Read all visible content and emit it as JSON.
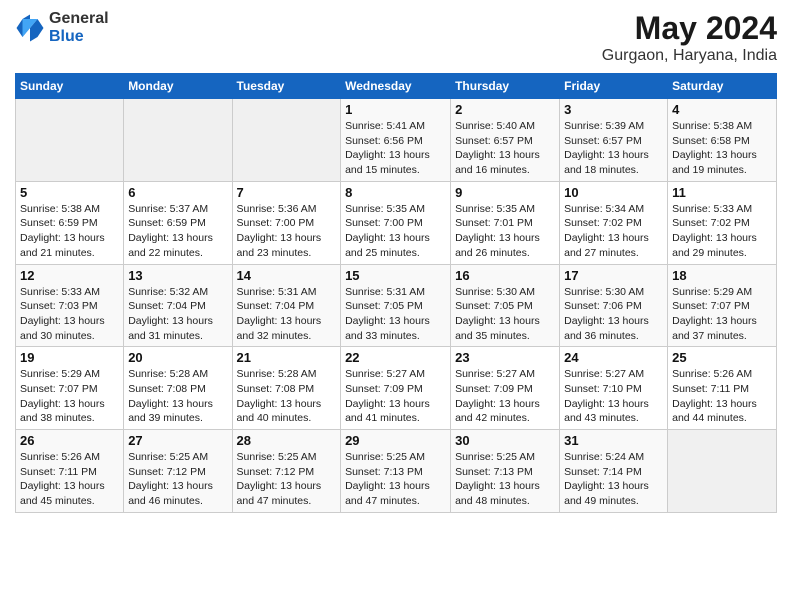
{
  "logo": {
    "general": "General",
    "blue": "Blue"
  },
  "title": "May 2024",
  "location": "Gurgaon, Haryana, India",
  "weekdays": [
    "Sunday",
    "Monday",
    "Tuesday",
    "Wednesday",
    "Thursday",
    "Friday",
    "Saturday"
  ],
  "weeks": [
    [
      {
        "day": "",
        "info": ""
      },
      {
        "day": "",
        "info": ""
      },
      {
        "day": "",
        "info": ""
      },
      {
        "day": "1",
        "info": "Sunrise: 5:41 AM\nSunset: 6:56 PM\nDaylight: 13 hours\nand 15 minutes."
      },
      {
        "day": "2",
        "info": "Sunrise: 5:40 AM\nSunset: 6:57 PM\nDaylight: 13 hours\nand 16 minutes."
      },
      {
        "day": "3",
        "info": "Sunrise: 5:39 AM\nSunset: 6:57 PM\nDaylight: 13 hours\nand 18 minutes."
      },
      {
        "day": "4",
        "info": "Sunrise: 5:38 AM\nSunset: 6:58 PM\nDaylight: 13 hours\nand 19 minutes."
      }
    ],
    [
      {
        "day": "5",
        "info": "Sunrise: 5:38 AM\nSunset: 6:59 PM\nDaylight: 13 hours\nand 21 minutes."
      },
      {
        "day": "6",
        "info": "Sunrise: 5:37 AM\nSunset: 6:59 PM\nDaylight: 13 hours\nand 22 minutes."
      },
      {
        "day": "7",
        "info": "Sunrise: 5:36 AM\nSunset: 7:00 PM\nDaylight: 13 hours\nand 23 minutes."
      },
      {
        "day": "8",
        "info": "Sunrise: 5:35 AM\nSunset: 7:00 PM\nDaylight: 13 hours\nand 25 minutes."
      },
      {
        "day": "9",
        "info": "Sunrise: 5:35 AM\nSunset: 7:01 PM\nDaylight: 13 hours\nand 26 minutes."
      },
      {
        "day": "10",
        "info": "Sunrise: 5:34 AM\nSunset: 7:02 PM\nDaylight: 13 hours\nand 27 minutes."
      },
      {
        "day": "11",
        "info": "Sunrise: 5:33 AM\nSunset: 7:02 PM\nDaylight: 13 hours\nand 29 minutes."
      }
    ],
    [
      {
        "day": "12",
        "info": "Sunrise: 5:33 AM\nSunset: 7:03 PM\nDaylight: 13 hours\nand 30 minutes."
      },
      {
        "day": "13",
        "info": "Sunrise: 5:32 AM\nSunset: 7:04 PM\nDaylight: 13 hours\nand 31 minutes."
      },
      {
        "day": "14",
        "info": "Sunrise: 5:31 AM\nSunset: 7:04 PM\nDaylight: 13 hours\nand 32 minutes."
      },
      {
        "day": "15",
        "info": "Sunrise: 5:31 AM\nSunset: 7:05 PM\nDaylight: 13 hours\nand 33 minutes."
      },
      {
        "day": "16",
        "info": "Sunrise: 5:30 AM\nSunset: 7:05 PM\nDaylight: 13 hours\nand 35 minutes."
      },
      {
        "day": "17",
        "info": "Sunrise: 5:30 AM\nSunset: 7:06 PM\nDaylight: 13 hours\nand 36 minutes."
      },
      {
        "day": "18",
        "info": "Sunrise: 5:29 AM\nSunset: 7:07 PM\nDaylight: 13 hours\nand 37 minutes."
      }
    ],
    [
      {
        "day": "19",
        "info": "Sunrise: 5:29 AM\nSunset: 7:07 PM\nDaylight: 13 hours\nand 38 minutes."
      },
      {
        "day": "20",
        "info": "Sunrise: 5:28 AM\nSunset: 7:08 PM\nDaylight: 13 hours\nand 39 minutes."
      },
      {
        "day": "21",
        "info": "Sunrise: 5:28 AM\nSunset: 7:08 PM\nDaylight: 13 hours\nand 40 minutes."
      },
      {
        "day": "22",
        "info": "Sunrise: 5:27 AM\nSunset: 7:09 PM\nDaylight: 13 hours\nand 41 minutes."
      },
      {
        "day": "23",
        "info": "Sunrise: 5:27 AM\nSunset: 7:09 PM\nDaylight: 13 hours\nand 42 minutes."
      },
      {
        "day": "24",
        "info": "Sunrise: 5:27 AM\nSunset: 7:10 PM\nDaylight: 13 hours\nand 43 minutes."
      },
      {
        "day": "25",
        "info": "Sunrise: 5:26 AM\nSunset: 7:11 PM\nDaylight: 13 hours\nand 44 minutes."
      }
    ],
    [
      {
        "day": "26",
        "info": "Sunrise: 5:26 AM\nSunset: 7:11 PM\nDaylight: 13 hours\nand 45 minutes."
      },
      {
        "day": "27",
        "info": "Sunrise: 5:25 AM\nSunset: 7:12 PM\nDaylight: 13 hours\nand 46 minutes."
      },
      {
        "day": "28",
        "info": "Sunrise: 5:25 AM\nSunset: 7:12 PM\nDaylight: 13 hours\nand 47 minutes."
      },
      {
        "day": "29",
        "info": "Sunrise: 5:25 AM\nSunset: 7:13 PM\nDaylight: 13 hours\nand 47 minutes."
      },
      {
        "day": "30",
        "info": "Sunrise: 5:25 AM\nSunset: 7:13 PM\nDaylight: 13 hours\nand 48 minutes."
      },
      {
        "day": "31",
        "info": "Sunrise: 5:24 AM\nSunset: 7:14 PM\nDaylight: 13 hours\nand 49 minutes."
      },
      {
        "day": "",
        "info": ""
      }
    ]
  ]
}
